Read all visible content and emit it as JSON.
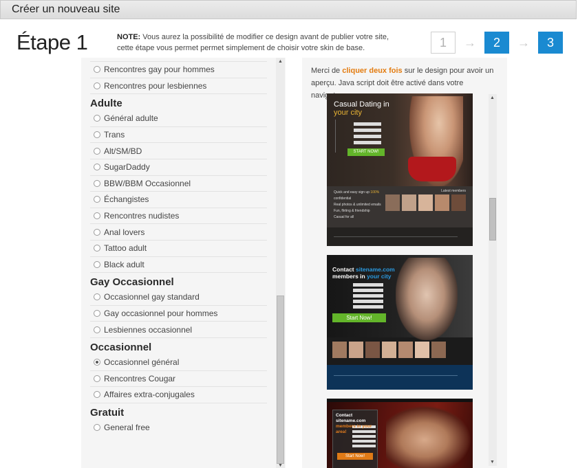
{
  "header": {
    "title": "Créer un nouveau site"
  },
  "step": {
    "title": "Étape 1",
    "note_label": "NOTE:",
    "note_text": " Vous aurez la possibilité de modifier ce design avant de publier votre site, cette étape vous permet permet simplement de choisir votre skin de base."
  },
  "stepper": [
    "1",
    "2",
    "3"
  ],
  "options": {
    "top": [
      "Rencontres gay pour hommes",
      "Rencontres pour lesbiennes"
    ],
    "adulte": {
      "heading": "Adulte",
      "items": [
        "Général adulte",
        "Trans",
        "Alt/SM/BD",
        "SugarDaddy",
        "BBW/BBM Occasionnel",
        "Échangistes",
        "Rencontres nudistes",
        "Anal lovers",
        "Tattoo adult",
        "Black adult"
      ]
    },
    "gay_occasionnel": {
      "heading": "Gay Occasionnel",
      "items": [
        "Occasionnel gay standard",
        "Gay occasionnel pour hommes",
        "Lesbiennes occasionnel"
      ]
    },
    "occasionnel": {
      "heading": "Occasionnel",
      "items": [
        "Occasionnel général",
        "Rencontres Cougar",
        "Affaires extra-conjugales"
      ],
      "selected": "Occasionnel général"
    },
    "gratuit": {
      "heading": "Gratuit",
      "items": [
        "General free"
      ]
    }
  },
  "preview": {
    "instruction_before": "Merci de ",
    "instruction_highlight": "cliquer deux fois",
    "instruction_after": " sur le design pour avoir un aperçu. Java script doit être activé dans votre navigateur",
    "templates": [
      {
        "headline_line1": "Casual Dating in",
        "headline_line2": "your city",
        "cta": "START NOW!",
        "bullet_1_before": "Quick and easy sign up ",
        "bullet_1_highlight": "100%",
        "bullet_1_after": " confidential",
        "bullet_2": "Real photos & unlimited emails",
        "bullet_3": "Fun, flirting & friendship",
        "bullet_4": "Casual for all",
        "members_label": "Latest members"
      },
      {
        "headline_line1": "Contact",
        "headline_brand": "sitename.com",
        "headline_line2_before": "members in ",
        "headline_line2_highlight": "your city",
        "cta": "Start Now!"
      },
      {
        "headline_line1_before": "Contact ",
        "headline_brand": "sitename.com",
        "headline_line2": "members in your area!",
        "cta": "Start Now!"
      }
    ]
  },
  "colors": {
    "accent_blue": "#1a8ad1",
    "highlight_orange": "#e37c10",
    "cta_green": "#63b52a"
  }
}
